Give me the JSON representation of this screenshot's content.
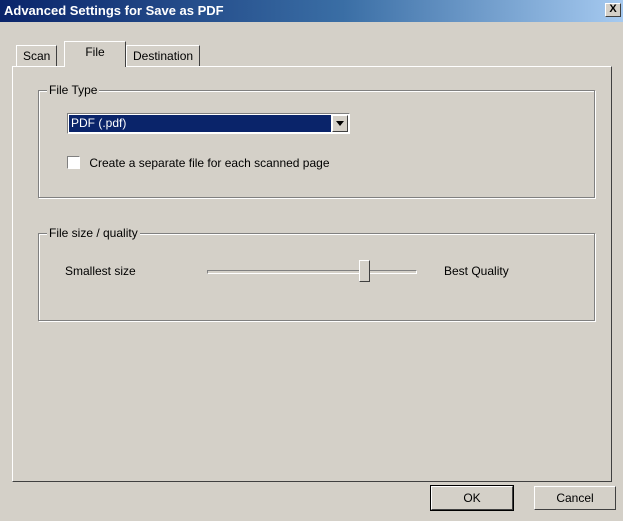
{
  "window": {
    "title": "Advanced Settings for Save as PDF",
    "close_label": "X"
  },
  "tabs": [
    {
      "label": "Scan",
      "active": false
    },
    {
      "label": "File",
      "active": true
    },
    {
      "label": "Destination",
      "active": false
    }
  ],
  "file_type": {
    "group_label": "File Type",
    "select_value": "PDF (.pdf)",
    "dropdown_icon": "chevron-down-icon",
    "separate_file_label": "Create a separate file for each scanned page",
    "separate_file_checked": false
  },
  "quality": {
    "group_label": "File size / quality",
    "min_label": "Smallest size",
    "max_label": "Best Quality",
    "slider_value": 0.75
  },
  "buttons": {
    "ok_label": "OK",
    "cancel_label": "Cancel"
  },
  "colors": {
    "dialog_bg": "#d4d0c8",
    "title_gradient_start": "#0a246a",
    "selection_bg": "#0a246a"
  }
}
